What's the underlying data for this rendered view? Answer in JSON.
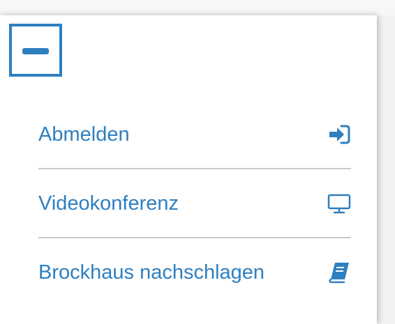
{
  "menu": {
    "collapse_icon": "minus-icon",
    "accent_color": "#2e7fc0",
    "items": [
      {
        "label": "Abmelden",
        "icon": "sign-in-icon"
      },
      {
        "label": "Videokonferenz",
        "icon": "desktop-icon"
      },
      {
        "label": "Brockhaus nachschlagen",
        "icon": "book-icon"
      }
    ]
  }
}
